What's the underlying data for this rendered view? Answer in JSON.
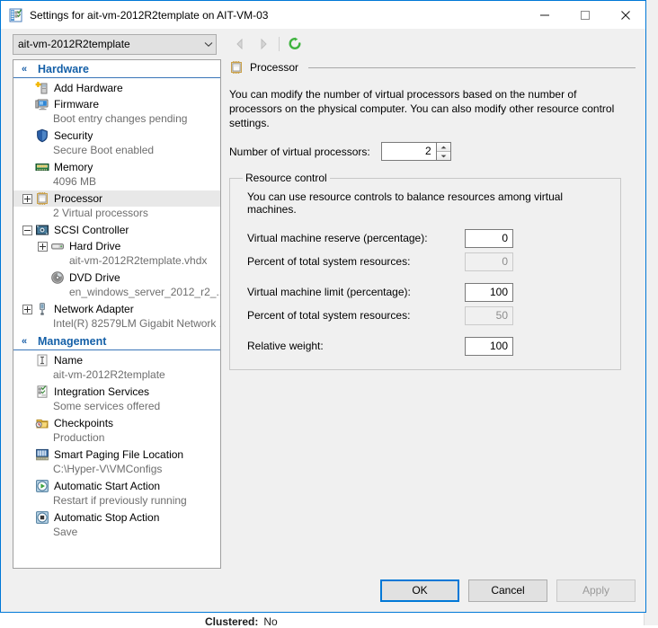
{
  "window": {
    "title": "Settings for ait-vm-2012R2template on AIT-VM-03",
    "icon": "settings-document-icon",
    "minimize_label": "—",
    "maximize_label": "☐",
    "close_label": "✕"
  },
  "toolbar": {
    "vm_selector_value": "ait-vm-2012R2template",
    "back_icon": "back-arrow-icon",
    "forward_icon": "forward-arrow-icon",
    "refresh_icon": "refresh-icon"
  },
  "tree": {
    "sections": [
      {
        "title": "Hardware",
        "chevron": "«",
        "items": [
          {
            "label": "Add Hardware",
            "sub": "",
            "icon": "add-hardware-icon",
            "expander": "none",
            "selected": false,
            "indent": 0
          },
          {
            "label": "Firmware",
            "sub": "Boot entry changes pending",
            "icon": "firmware-icon",
            "expander": "none",
            "selected": false,
            "indent": 0
          },
          {
            "label": "Security",
            "sub": "Secure Boot enabled",
            "icon": "security-shield-icon",
            "expander": "none",
            "selected": false,
            "indent": 0
          },
          {
            "label": "Memory",
            "sub": "4096 MB",
            "icon": "memory-icon",
            "expander": "none",
            "selected": false,
            "indent": 0
          },
          {
            "label": "Processor",
            "sub": "2 Virtual processors",
            "icon": "processor-icon",
            "expander": "plus",
            "selected": true,
            "indent": 0
          },
          {
            "label": "SCSI Controller",
            "sub": "",
            "icon": "scsi-controller-icon",
            "expander": "minus",
            "selected": false,
            "indent": 0
          },
          {
            "label": "Hard Drive",
            "sub": "ait-vm-2012R2template.vhdx",
            "icon": "hard-drive-icon",
            "expander": "plus",
            "selected": false,
            "indent": 1
          },
          {
            "label": "DVD Drive",
            "sub": "en_windows_server_2012_r2_...",
            "icon": "dvd-drive-icon",
            "expander": "none",
            "selected": false,
            "indent": 1
          },
          {
            "label": "Network Adapter",
            "sub": "Intel(R) 82579LM Gigabit Network ...",
            "icon": "network-adapter-icon",
            "expander": "plus",
            "selected": false,
            "indent": 0
          }
        ]
      },
      {
        "title": "Management",
        "chevron": "«",
        "items": [
          {
            "label": "Name",
            "sub": "ait-vm-2012R2template",
            "icon": "name-icon",
            "expander": "none",
            "selected": false,
            "indent": 0
          },
          {
            "label": "Integration Services",
            "sub": "Some services offered",
            "icon": "integration-services-icon",
            "expander": "none",
            "selected": false,
            "indent": 0
          },
          {
            "label": "Checkpoints",
            "sub": "Production",
            "icon": "checkpoints-icon",
            "expander": "none",
            "selected": false,
            "indent": 0
          },
          {
            "label": "Smart Paging File Location",
            "sub": "C:\\Hyper-V\\VMConfigs",
            "icon": "smart-paging-icon",
            "expander": "none",
            "selected": false,
            "indent": 0
          },
          {
            "label": "Automatic Start Action",
            "sub": "Restart if previously running",
            "icon": "auto-start-icon",
            "expander": "none",
            "selected": false,
            "indent": 0
          },
          {
            "label": "Automatic Stop Action",
            "sub": "Save",
            "icon": "auto-stop-icon",
            "expander": "none",
            "selected": false,
            "indent": 0
          }
        ]
      }
    ]
  },
  "panel": {
    "header": "Processor",
    "header_icon": "processor-icon",
    "description": "You can modify the number of virtual processors based on the number of processors on the physical computer. You can also modify other resource control settings.",
    "vcpu_label": "Number of virtual processors:",
    "vcpu_value": "2",
    "resource_control": {
      "legend": "Resource control",
      "description": "You can use resource controls to balance resources among virtual machines.",
      "rows": [
        {
          "label": "Virtual machine reserve (percentage):",
          "value": "0",
          "disabled": false
        },
        {
          "label": "Percent of total system resources:",
          "value": "0",
          "disabled": true
        },
        {
          "label": "Virtual machine limit (percentage):",
          "value": "100",
          "disabled": false
        },
        {
          "label": "Percent of total system resources:",
          "value": "50",
          "disabled": true
        },
        {
          "label": "Relative weight:",
          "value": "100",
          "disabled": false
        }
      ]
    }
  },
  "footer": {
    "ok": "OK",
    "cancel": "Cancel",
    "apply": "Apply"
  },
  "background": {
    "clustered_label": "Clustered:",
    "clustered_value": "No"
  },
  "colors": {
    "accent": "#0078d7",
    "section_title": "#1560a8",
    "dialog_bg": "#f0f0f0",
    "sub_text": "#6e6e6e"
  }
}
